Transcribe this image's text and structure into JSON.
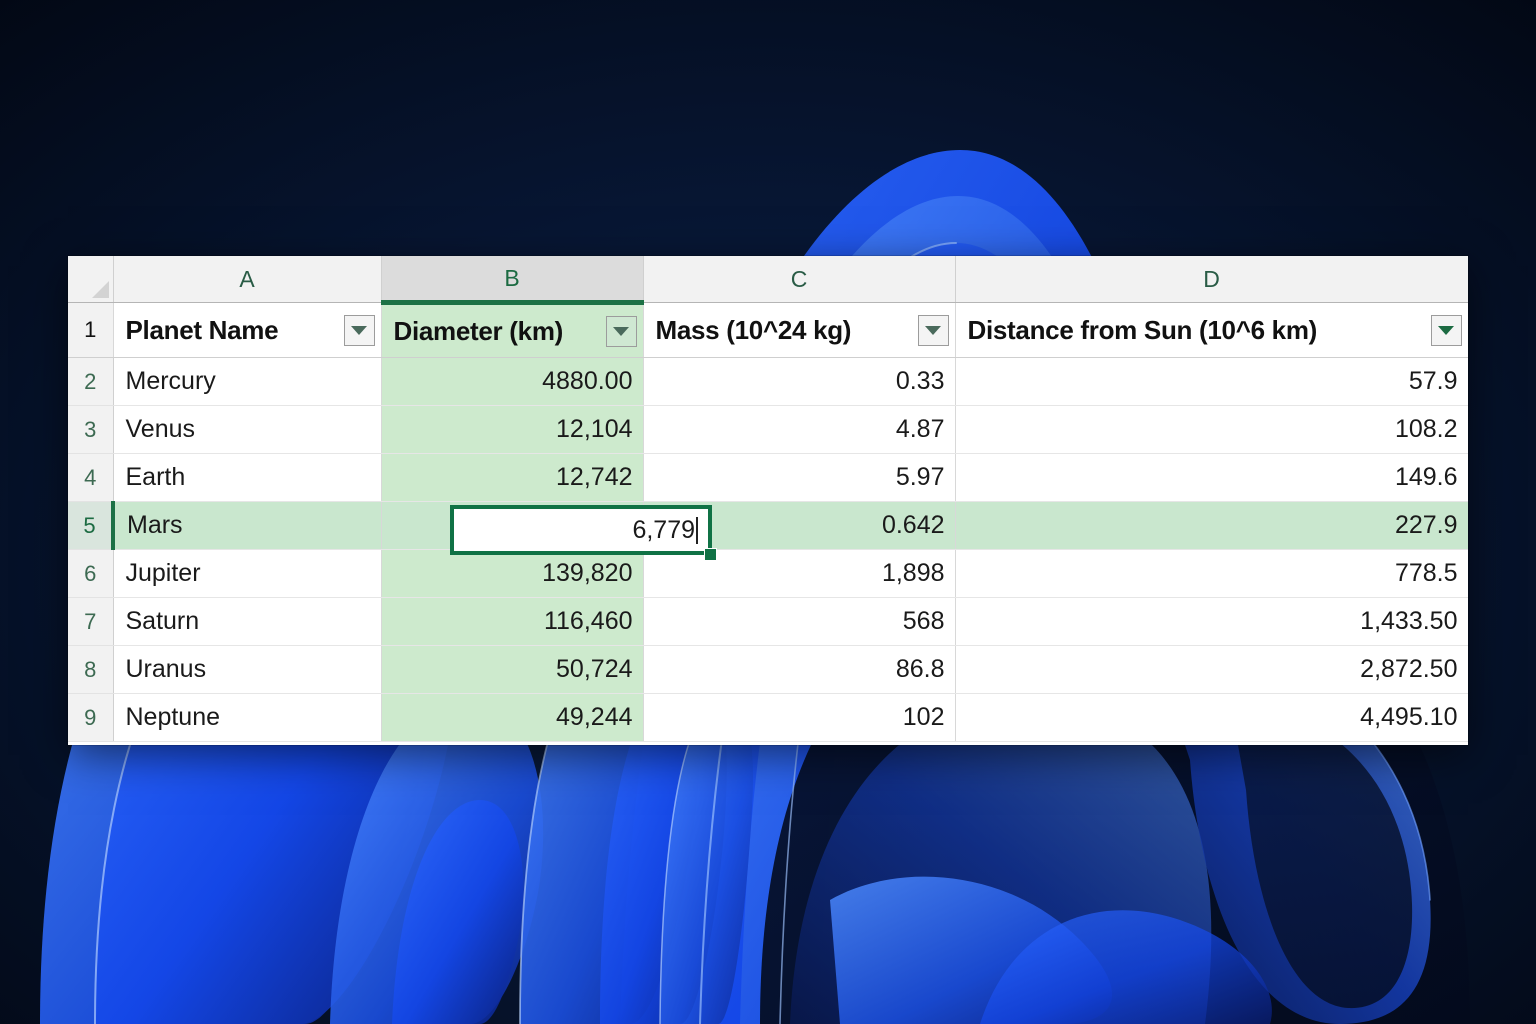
{
  "app": {
    "kind": "spreadsheet",
    "accent_green": "#107245",
    "highlight_green": "#cdeacd",
    "selected_row_green": "#c9e7ce",
    "header_gray": "#f2f2f2"
  },
  "grid": {
    "column_letters": [
      "A",
      "B",
      "C",
      "D"
    ],
    "selected_column_letter": "B",
    "row_numbers": [
      "1",
      "2",
      "3",
      "4",
      "5",
      "6",
      "7",
      "8",
      "9"
    ],
    "selected_row_number": "5",
    "corner_icon": "select-all-triangle-icon"
  },
  "table": {
    "headers": [
      {
        "label": "Planet Name",
        "filter_icon": "filter-dropdown-icon",
        "filter_active": false,
        "shaded": false
      },
      {
        "label": "Diameter (km)",
        "filter_icon": "filter-dropdown-icon",
        "filter_active": false,
        "shaded": true
      },
      {
        "label": "Mass (10^24 kg)",
        "filter_icon": "filter-dropdown-icon",
        "filter_active": false,
        "shaded": false
      },
      {
        "label": "Distance from Sun (10^6 km)",
        "filter_icon": "filter-dropdown-icon",
        "filter_active": true,
        "shaded": false
      }
    ],
    "rows": [
      {
        "row": "2",
        "name": "Mercury",
        "diameter": "4880.00",
        "mass": "0.33",
        "distance": "57.9",
        "selected": false
      },
      {
        "row": "3",
        "name": "Venus",
        "diameter": "12,104",
        "mass": "4.87",
        "distance": "108.2",
        "selected": false
      },
      {
        "row": "4",
        "name": "Earth",
        "diameter": "12,742",
        "mass": "5.97",
        "distance": "149.6",
        "selected": false
      },
      {
        "row": "5",
        "name": "Mars",
        "diameter": "6,779",
        "mass": "0.642",
        "distance": "227.9",
        "selected": true
      },
      {
        "row": "6",
        "name": "Jupiter",
        "diameter": "139,820",
        "mass": "1,898",
        "distance": "778.5",
        "selected": false
      },
      {
        "row": "7",
        "name": "Saturn",
        "diameter": "116,460",
        "mass": "568",
        "distance": "1,433.50",
        "selected": false
      },
      {
        "row": "8",
        "name": "Uranus",
        "diameter": "50,724",
        "mass": "86.8",
        "distance": "2,872.50",
        "selected": false
      },
      {
        "row": "9",
        "name": "Neptune",
        "diameter": "49,244",
        "mass": "102",
        "distance": "4,495.10",
        "selected": false
      }
    ]
  },
  "active_cell": {
    "reference": "B5",
    "value": "6,779",
    "editing": true,
    "fill_handle": "fill-handle"
  }
}
